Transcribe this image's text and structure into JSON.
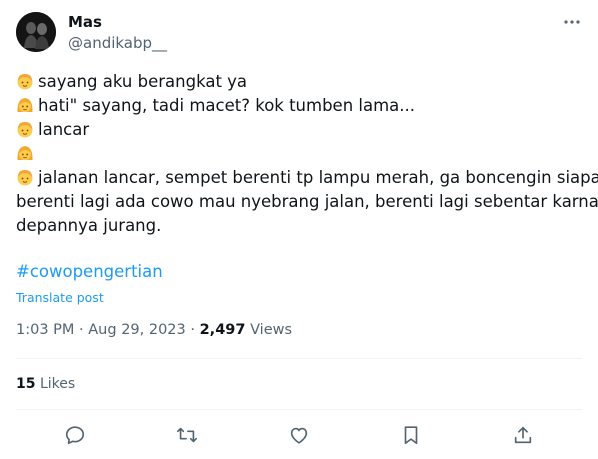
{
  "user": {
    "name": "Mas",
    "handle": "@andikabp__"
  },
  "tweet": {
    "lines": [
      "sayang aku berangkat ya",
      "hati\" sayang, tadi macet? kok tumben lama...",
      "lancar",
      "",
      "jalanan lancar, sempet berenti tp lampu merah, ga boncengin siapa\",",
      "berenti lagi ada cowo mau nyebrang jalan, berenti lagi sebentar karna",
      "depannya jurang."
    ],
    "emoji_icons": [
      "boy-emoji-icon",
      "girl-emoji-icon",
      "boy-emoji-icon",
      "girl-emoji-icon",
      "boy-emoji-icon"
    ],
    "hashtag": "#cowopengertian",
    "translate_label": "Translate post"
  },
  "meta": {
    "time": "1:03 PM",
    "separator": "·",
    "date": "Aug 29, 2023",
    "views_count": "2,497",
    "views_label": "Views"
  },
  "stats": {
    "likes_count": "15",
    "likes_label": "Likes"
  },
  "actions": [
    "reply-icon",
    "retweet-icon",
    "like-icon",
    "bookmark-icon",
    "share-icon"
  ],
  "colors": {
    "accent": "#1d9bf0",
    "text": "#0f1419",
    "secondary": "#536471",
    "divider": "#eff3f4",
    "boy_emoji": "#f4b73b",
    "girl_emoji_hair": "#f4a72a"
  }
}
